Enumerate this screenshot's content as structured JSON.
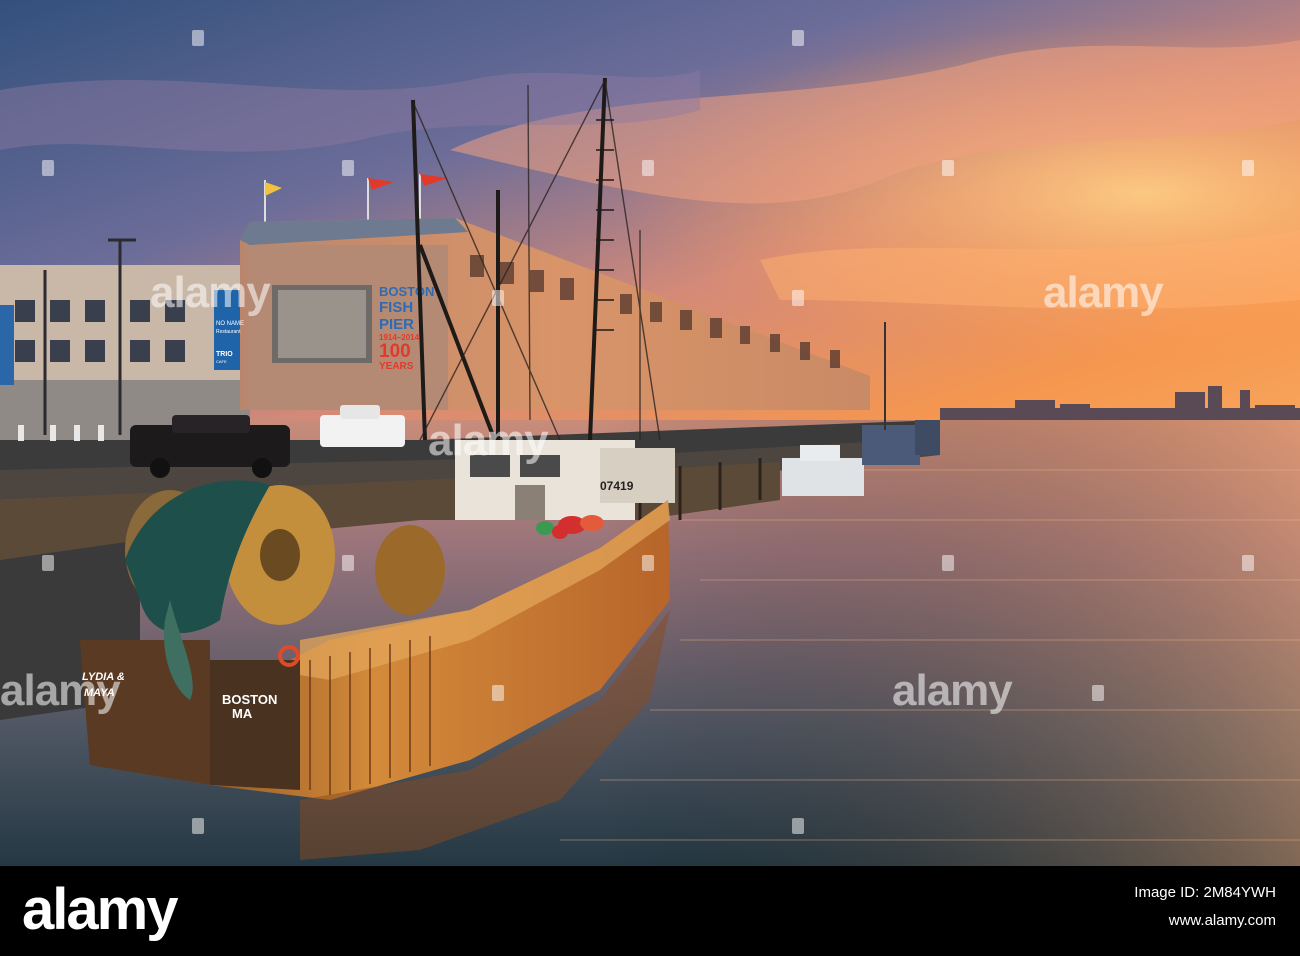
{
  "scene": {
    "description_tags": [
      "fishing-trawler",
      "pier",
      "harbor",
      "sunset-sky",
      "city-skyline"
    ],
    "sky_colors": [
      "#3f5a86",
      "#8d7aa0",
      "#e8a27a",
      "#f59b5a",
      "#f8b66c"
    ],
    "water_colors": [
      "#40505f",
      "#8b6f70",
      "#d59973",
      "#2c3f4a"
    ]
  },
  "boat": {
    "name_line1": "LYDIA &",
    "name_line2": "MAYA",
    "port_line1": "BOSTON",
    "port_line2": "MA",
    "hull_number": "07419"
  },
  "building_banner": {
    "line1": "BOSTON",
    "line2": "FISH",
    "line3": "PIER",
    "years": "1914–2014",
    "line4": "100",
    "line5": "YEARS"
  },
  "left_building_sign": {
    "line1": "NO NAME",
    "line2": "Restaurant",
    "line3": "TRIO",
    "line4": "CAFE"
  },
  "watermark": {
    "text": "alamy"
  },
  "footer": {
    "logo": "alamy",
    "image_id_label": "Image ID: 2M84YWH",
    "url": "www.alamy.com"
  },
  "colors": {
    "hull": "#c9782e",
    "rust": "#8a4a1e",
    "building": "#c98a66",
    "footer_bg": "#000000"
  }
}
